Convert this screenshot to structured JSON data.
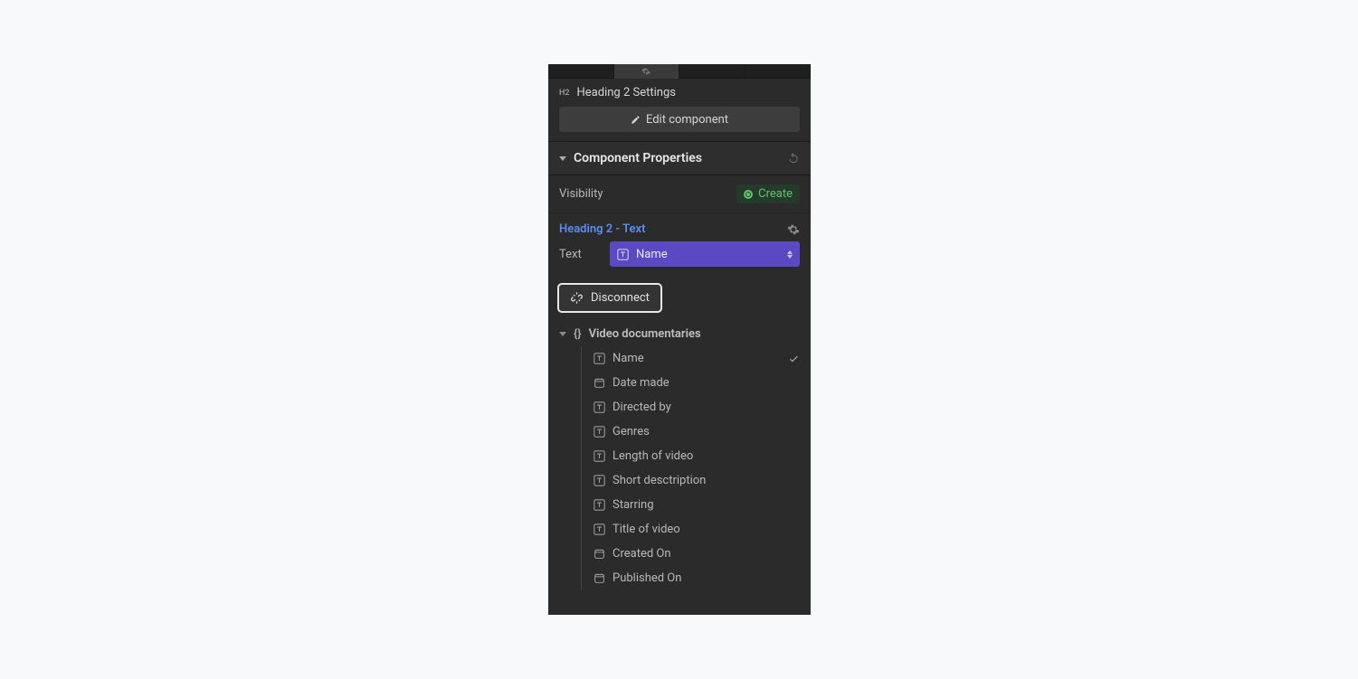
{
  "settings": {
    "badge": "H2",
    "title": "Heading 2 Settings",
    "editComponentLabel": "Edit component"
  },
  "componentProperties": {
    "sectionTitle": "Component Properties",
    "visibilityLabel": "Visibility",
    "createLabel": "Create",
    "heading2TextLabel": "Heading 2 - Text",
    "textLabel": "Text",
    "boundFieldName": "Name"
  },
  "disconnect": {
    "label": "Disconnect"
  },
  "collection": {
    "name": "Video documentaries",
    "fields": [
      {
        "type": "text",
        "label": "Name",
        "selected": true
      },
      {
        "type": "date",
        "label": "Date made",
        "selected": false
      },
      {
        "type": "text",
        "label": "Directed by",
        "selected": false
      },
      {
        "type": "text",
        "label": "Genres",
        "selected": false
      },
      {
        "type": "text",
        "label": "Length of video",
        "selected": false
      },
      {
        "type": "text",
        "label": "Short desctription",
        "selected": false
      },
      {
        "type": "text",
        "label": "Starring",
        "selected": false
      },
      {
        "type": "text",
        "label": "Title of video",
        "selected": false
      },
      {
        "type": "date",
        "label": "Created On",
        "selected": false
      },
      {
        "type": "date",
        "label": "Published On",
        "selected": false
      }
    ]
  }
}
